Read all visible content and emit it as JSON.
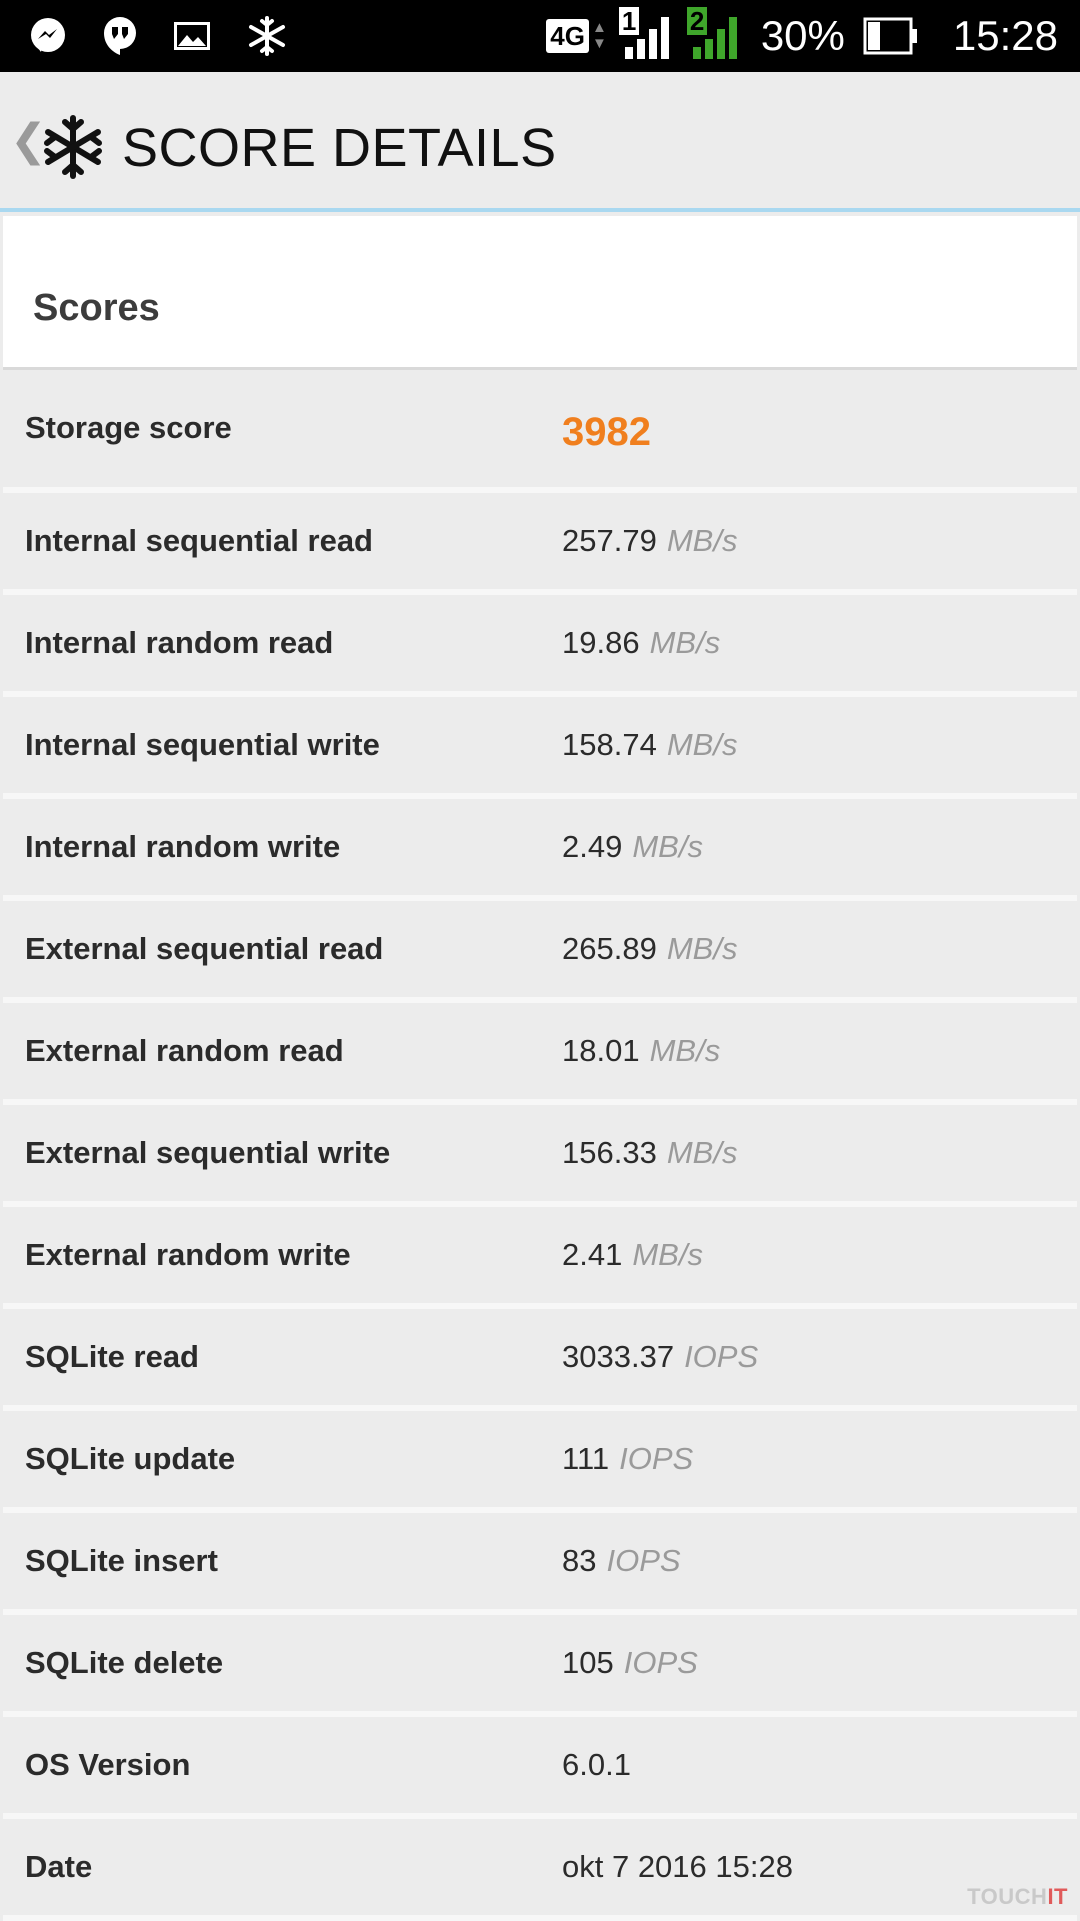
{
  "status_bar": {
    "icons_left": [
      "messenger-icon",
      "hangouts-icon",
      "gallery-icon",
      "snowflake-icon"
    ],
    "network": "4G",
    "sim1": "1",
    "sim2": "2",
    "battery": "30%",
    "battery_level_percent": 30,
    "time": "15:28"
  },
  "header": {
    "back": "❮",
    "title": "SCORE DETAILS"
  },
  "card": {
    "title": "Scores"
  },
  "rows": [
    {
      "label": "Storage score",
      "value": "3982",
      "unit": ""
    },
    {
      "label": "Internal sequential read",
      "value": "257.79",
      "unit": "MB/s"
    },
    {
      "label": "Internal random read",
      "value": "19.86",
      "unit": "MB/s"
    },
    {
      "label": "Internal sequential write",
      "value": "158.74",
      "unit": "MB/s"
    },
    {
      "label": "Internal random write",
      "value": "2.49",
      "unit": "MB/s"
    },
    {
      "label": "External sequential read",
      "value": "265.89",
      "unit": "MB/s"
    },
    {
      "label": "External random read",
      "value": "18.01",
      "unit": "MB/s"
    },
    {
      "label": "External sequential write",
      "value": "156.33",
      "unit": "MB/s"
    },
    {
      "label": "External random write",
      "value": "2.41",
      "unit": "MB/s"
    },
    {
      "label": "SQLite read",
      "value": "3033.37",
      "unit": "IOPS"
    },
    {
      "label": "SQLite update",
      "value": "111",
      "unit": "IOPS"
    },
    {
      "label": "SQLite insert",
      "value": "83",
      "unit": "IOPS"
    },
    {
      "label": "SQLite delete",
      "value": "105",
      "unit": "IOPS"
    },
    {
      "label": "OS Version",
      "value": "6.0.1",
      "unit": ""
    },
    {
      "label": "Date",
      "value": "okt 7 2016 15:28",
      "unit": ""
    }
  ],
  "watermark": {
    "prefix": "TOUCH",
    "suffix": "IT"
  },
  "colors": {
    "score_accent": "#f07f1e",
    "header_border": "#a9d8f0",
    "sim_active": "#3fa62b"
  }
}
